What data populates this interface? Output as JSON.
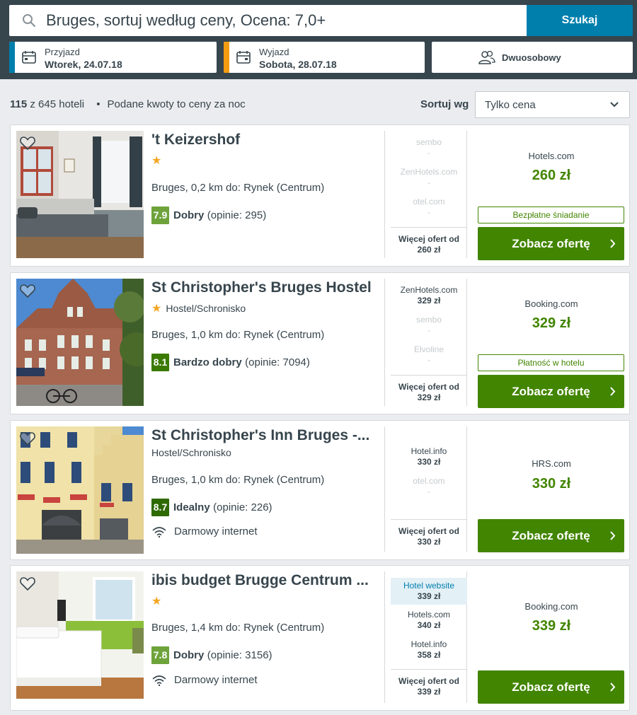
{
  "search": {
    "query": "Bruges, sortuj według ceny, Ocena: 7,0+",
    "button_label": "Szukaj"
  },
  "checkin": {
    "label": "Przyjazd",
    "value": "Wtorek, 24.07.18",
    "accent": "#007fad"
  },
  "checkout": {
    "label": "Wyjazd",
    "value": "Sobota, 28.07.18",
    "accent": "#f39c12"
  },
  "room": {
    "value": "Dwuosobowy"
  },
  "summary": {
    "count": "115",
    "total": "z 645 hoteli",
    "separator": "•",
    "note": "Podane kwoty to ceny za noc"
  },
  "sort": {
    "label": "Sortuj wg",
    "value": "Tylko cena"
  },
  "colors": {
    "header_bg": "#37454d",
    "brand_blue": "#007fad",
    "cta_green": "#428500",
    "rating_dark": "#3b7a00",
    "rating_light": "#6ea33b"
  },
  "hotels": [
    {
      "name": "'t Keizershof",
      "stars": "★",
      "type": "",
      "location": "Bruges, 0,2 km do: Rynek (Centrum)",
      "score": "7.9",
      "rating_label": "Dobry",
      "reviews": "(opinie: 295)",
      "amenity": "",
      "offers": [
        {
          "provider": "sembo",
          "price": "-"
        },
        {
          "provider": "ZenHotels.com",
          "price": "-"
        },
        {
          "provider": "otel.com",
          "price": "-"
        }
      ],
      "more_label": "Więcej ofert od",
      "more_price": "260 zł",
      "best_provider": "Hotels.com",
      "best_price": "260 zł",
      "badge": "Bezpłatne śniadanie",
      "cta": "Zobacz ofertę"
    },
    {
      "name": "St Christopher's Bruges Hostel",
      "stars": "★",
      "type": "Hostel/Schronisko",
      "location": "Bruges, 1,0 km do: Rynek (Centrum)",
      "score": "8.1",
      "rating_label": "Bardzo dobry",
      "reviews": "(opinie: 7094)",
      "amenity": "",
      "offers": [
        {
          "provider": "ZenHotels.com",
          "price": "329 zł"
        },
        {
          "provider": "sembo",
          "price": "-"
        },
        {
          "provider": "Elvoline",
          "price": "-"
        }
      ],
      "more_label": "Więcej ofert od",
      "more_price": "329 zł",
      "best_provider": "Booking.com",
      "best_price": "329 zł",
      "badge": "Płatność w hotelu",
      "cta": "Zobacz ofertę"
    },
    {
      "name": "St Christopher's Inn Bruges -...",
      "stars": "",
      "type": "Hostel/Schronisko",
      "location": "Bruges, 1,0 km do: Rynek (Centrum)",
      "score": "8.7",
      "rating_label": "Idealny",
      "reviews": "(opinie: 226)",
      "amenity": "Darmowy internet",
      "offers": [
        {
          "provider": "Hotel.info",
          "price": "330 zł"
        },
        {
          "provider": "otel.com",
          "price": "-"
        }
      ],
      "more_label": "Więcej ofert od",
      "more_price": "330 zł",
      "best_provider": "HRS.com",
      "best_price": "330 zł",
      "badge": "",
      "cta": "Zobacz ofertę"
    },
    {
      "name": "ibis budget Brugge Centrum ...",
      "stars": "★",
      "type": "",
      "location": "Bruges, 1,4 km do: Rynek (Centrum)",
      "score": "7.8",
      "rating_label": "Dobry",
      "reviews": "(opinie: 3156)",
      "amenity": "Darmowy internet",
      "offers": [
        {
          "provider": "Hotel website",
          "price": "339 zł"
        },
        {
          "provider": "Hotels.com",
          "price": "340 zł"
        },
        {
          "provider": "Hotel.info",
          "price": "358 zł"
        }
      ],
      "more_label": "Więcej ofert od",
      "more_price": "339 zł",
      "best_provider": "Booking.com",
      "best_price": "339 zł",
      "badge": "",
      "cta": "Zobacz ofertę"
    }
  ]
}
